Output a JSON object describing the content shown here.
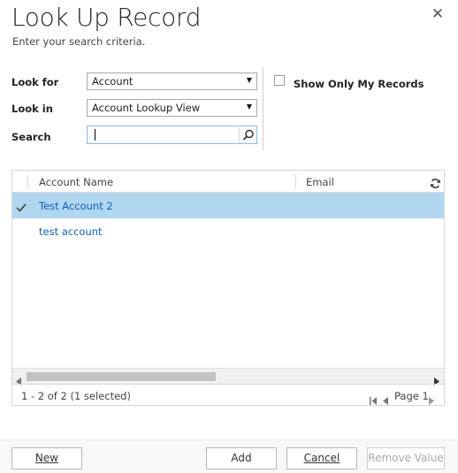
{
  "dialog": {
    "title": "Look Up Record",
    "subtitle": "Enter your search criteria.",
    "close_icon": "close-icon"
  },
  "form": {
    "look_for_label": "Look for",
    "look_for_value": "Account",
    "look_in_label": "Look in",
    "look_in_value": "Account Lookup View",
    "search_label": "Search",
    "search_value": "",
    "show_only_my_records_label": "Show Only My Records",
    "show_only_my_records_checked": false
  },
  "grid": {
    "columns": [
      "Account Name",
      "Email"
    ],
    "rows": [
      {
        "name": "Test Account 2",
        "email": "",
        "selected": true
      },
      {
        "name": "test account",
        "email": "",
        "selected": false
      }
    ],
    "status": "1 - 2 of 2 (1 selected)",
    "page_label": "Page 1"
  },
  "buttons": {
    "new_label": "New",
    "add_label": "Add",
    "cancel_label": "Cancel",
    "remove_value_label": "Remove Value"
  },
  "colors": {
    "selected_row": "#b1d6f0",
    "link": "#1160b7"
  }
}
